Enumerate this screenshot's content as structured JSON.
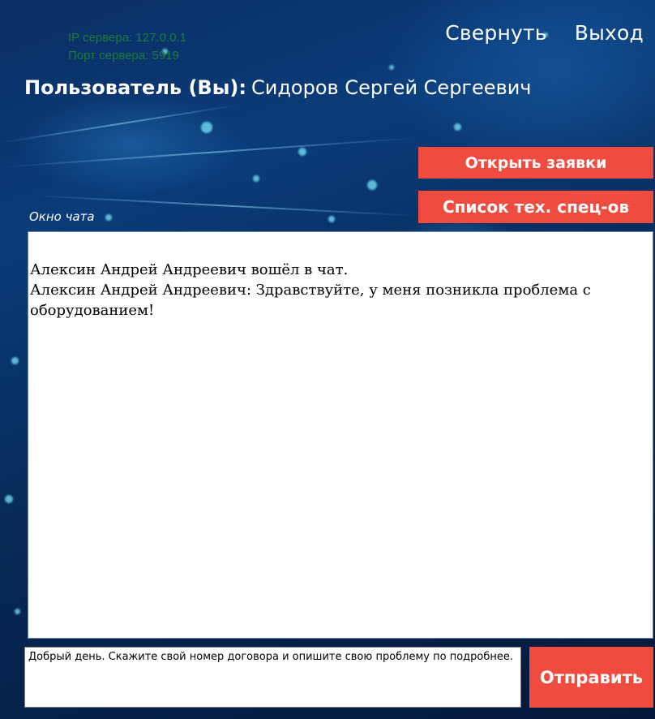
{
  "server": {
    "ip_line": "IP сервера: 127.0.0.1",
    "port_line": "Порт сервера: 5919"
  },
  "header": {
    "minimize_label": "Свернуть",
    "exit_label": "Выход"
  },
  "user": {
    "label": "Пользователь (Вы):",
    "name": "Сидоров Сергей Сергеевич"
  },
  "buttons": {
    "open_requests": "Открыть заявки",
    "tech_specialists": "Список тех. спец-ов",
    "send": "Отправить"
  },
  "chat": {
    "caption": "Окно чата",
    "messages": [
      "Алексин Андрей Андреевич вошёл в чат.",
      "Алексин Андрей Андреевич: Здравствуйте, у меня позникла проблема с оборудованием!"
    ]
  },
  "message_input": {
    "value": "Добрый день. Скажите свой номер договора и опишите свою проблему по подробнее."
  },
  "colors": {
    "accent_button": "#f04b3f",
    "server_text": "#1f7a3a",
    "background": "#0a3c7a"
  }
}
